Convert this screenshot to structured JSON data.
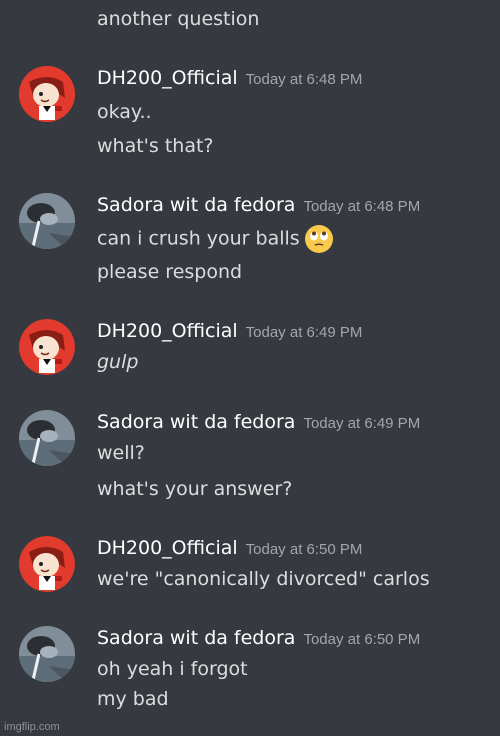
{
  "top_line": "another question",
  "messages": [
    {
      "user": "DH200_Official",
      "time": "Today at 6:48 PM",
      "avatar": "avatar-red-character",
      "lines": [
        "okay..",
        "what's that?"
      ]
    },
    {
      "user": "Sadora wit da fedora",
      "time": "Today at 6:48 PM",
      "avatar": "avatar-gray-character",
      "lines": [
        "can i crush your balls",
        "please respond"
      ],
      "emoji": "rolling-eyes-emoji"
    },
    {
      "user": "DH200_Official",
      "time": "Today at 6:49 PM",
      "avatar": "avatar-red-character",
      "lines": [
        "gulp"
      ]
    },
    {
      "user": "Sadora wit da fedora",
      "time": "Today at 6:49 PM",
      "avatar": "avatar-gray-character",
      "lines": [
        "well?",
        "what's your answer?"
      ]
    },
    {
      "user": "DH200_Official",
      "time": "Today at 6:50 PM",
      "avatar": "avatar-red-character",
      "lines": [
        "we're \"canonically divorced\" carlos"
      ]
    },
    {
      "user": "Sadora wit da fedora",
      "time": "Today at 6:50 PM",
      "avatar": "avatar-gray-character",
      "lines": [
        "oh yeah i forgot",
        "my bad"
      ]
    }
  ],
  "watermark": "imgflip.com",
  "colors": {
    "background": "#36393f",
    "username": "#ffffff",
    "timestamp": "#a3a6aa",
    "message_text": "#dcddde"
  }
}
